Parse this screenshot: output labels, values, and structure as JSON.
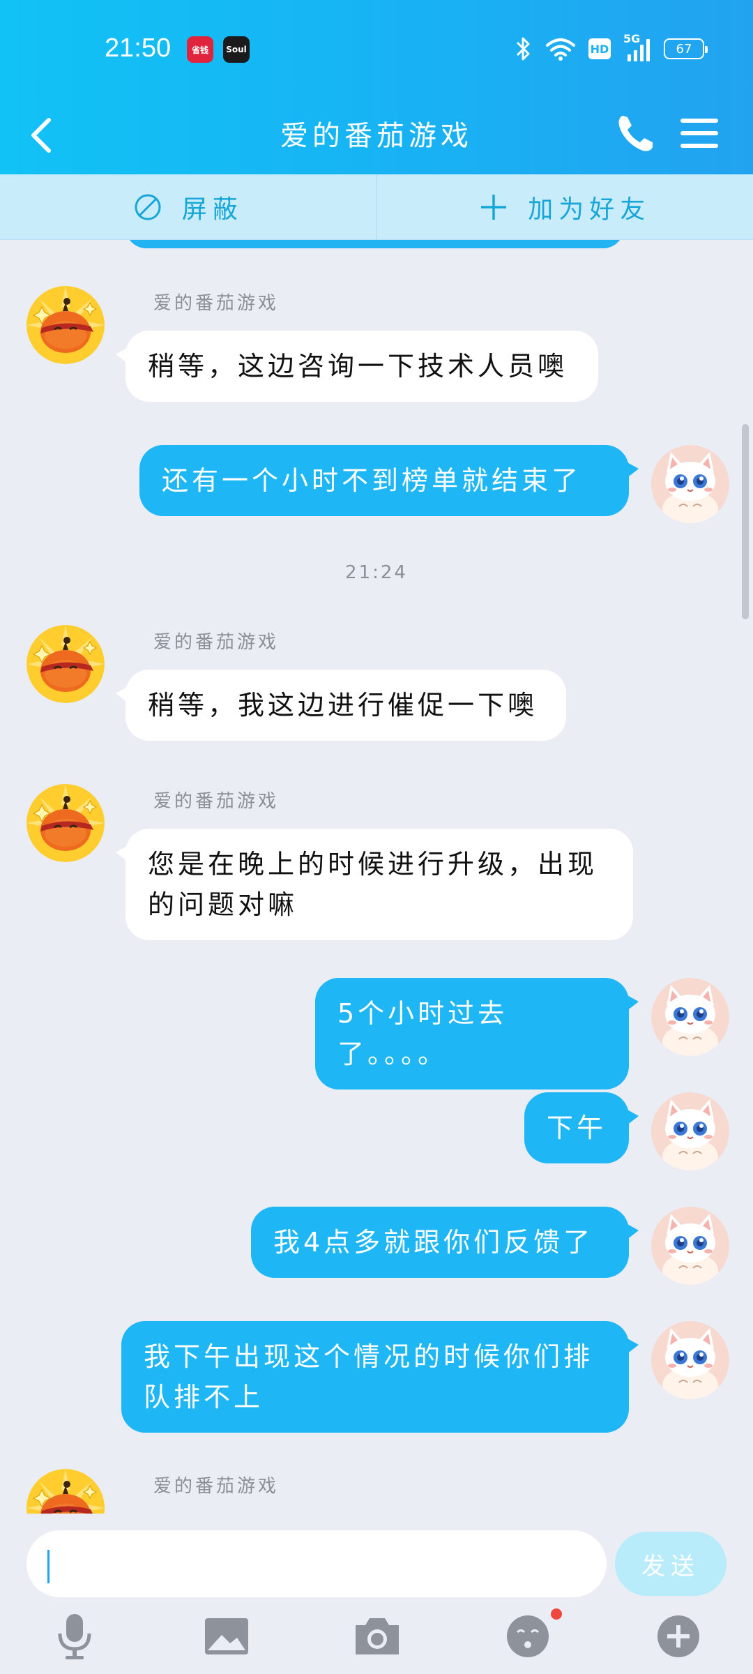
{
  "status_bar": {
    "time": "21:50",
    "app_icons": [
      "省钱",
      "Soul"
    ],
    "hd": "HD",
    "network": "5G",
    "battery": "67"
  },
  "nav": {
    "title": "爱的番茄游戏"
  },
  "actions": {
    "block_label": "屏蔽",
    "add_friend_label": "加为好友"
  },
  "messages": [
    {
      "side": "in",
      "sender": "爱的番茄游戏",
      "text": "稍等，这边咨询一下技术人员噢"
    },
    {
      "side": "out",
      "text": "还有一个小时不到榜单就结束了"
    },
    {
      "type": "time",
      "text": "21:24"
    },
    {
      "side": "in",
      "sender": "爱的番茄游戏",
      "text": "稍等，我这边进行催促一下噢"
    },
    {
      "side": "in",
      "sender": "爱的番茄游戏",
      "text": "您是在晚上的时候进行升级，出现的问题对嘛"
    },
    {
      "side": "out",
      "text": "5个小时过去了。。。。"
    },
    {
      "side": "out",
      "text": "下午"
    },
    {
      "side": "out",
      "text": "我4点多就跟你们反馈了"
    },
    {
      "side": "out",
      "text": "我下午出现这个情况的时候你们排队排不上"
    },
    {
      "side": "in",
      "sender": "爱的番茄游戏",
      "text": ""
    }
  ],
  "input": {
    "value": "",
    "send_label": "发送"
  },
  "toolbar": [
    "microphone-icon",
    "image-icon",
    "camera-icon",
    "emoji-icon",
    "plus-icon"
  ],
  "colors": {
    "header": "#18b2f4",
    "bubble_out": "#1fb6f5",
    "bubble_in": "#ffffff",
    "background": "#eaedf4",
    "action_bar": "#c9ecfa"
  }
}
